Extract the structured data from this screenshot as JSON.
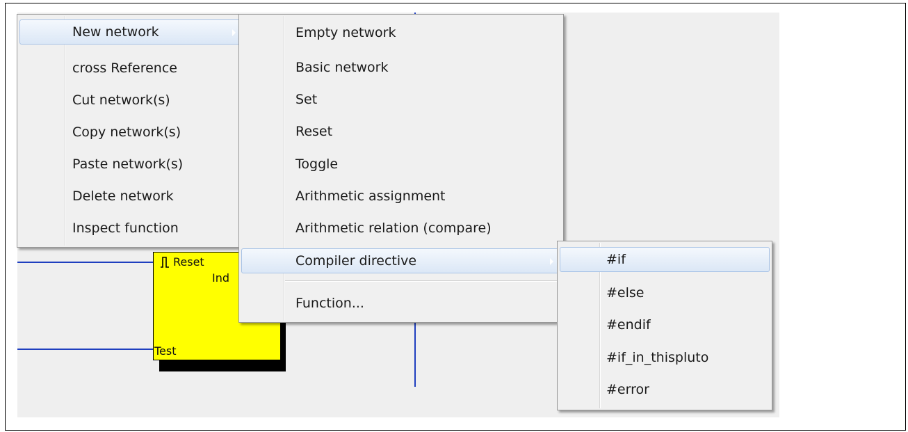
{
  "diagram": {
    "block": {
      "pin_reset": "Reset",
      "pin_ind": "Ind",
      "pin_test": "Test"
    }
  },
  "context_menu": {
    "items": [
      {
        "label": "New network",
        "highlighted": true,
        "submenu": true
      },
      {
        "label": "cross Reference"
      },
      {
        "label": "Cut network(s)"
      },
      {
        "label": "Copy network(s)"
      },
      {
        "label": "Paste network(s)"
      },
      {
        "label": "Delete network"
      },
      {
        "label": "Inspect function"
      }
    ]
  },
  "new_network_submenu": {
    "items": [
      {
        "label": "Empty network"
      },
      {
        "label": "Basic network"
      },
      {
        "label": "Set"
      },
      {
        "label": "Reset"
      },
      {
        "label": "Toggle"
      },
      {
        "label": "Arithmetic assignment"
      },
      {
        "label": "Arithmetic relation (compare)"
      },
      {
        "label": "Compiler directive",
        "highlighted": true,
        "submenu": true
      },
      {
        "label": "Function..."
      }
    ]
  },
  "compiler_directive_submenu": {
    "items": [
      {
        "label": "#if",
        "highlighted": true
      },
      {
        "label": "#else"
      },
      {
        "label": "#endif"
      },
      {
        "label": "#if_in_thispluto"
      },
      {
        "label": "#error"
      }
    ]
  }
}
